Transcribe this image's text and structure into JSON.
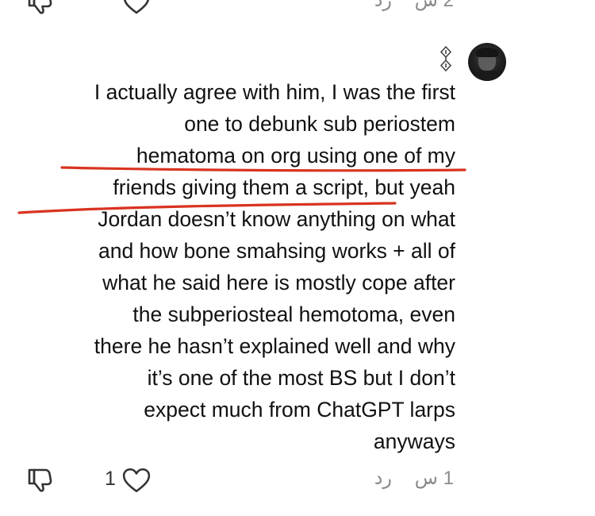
{
  "previous_comment": {
    "time_label": "2 س",
    "reply_label": "رد"
  },
  "comment": {
    "avatar_icon": "profile-photo",
    "badge_icon": "diamond-chain-icon",
    "lines": [
      "I actually agree with him, I was the first",
      "one to debunk sub periostem",
      "hematoma on org using one of my",
      "friends giving them a script, but yeah",
      "Jordan doesn’t know anything on what",
      "and how bone smahsing works + all of",
      "what he said here is mostly cope after",
      "the subperiosteal hemotoma, even",
      "there he hasn’t explained well and why",
      "it’s one of the most BS but I don’t",
      "expect much from ChatGPT larps",
      "anyways"
    ],
    "like_count": "1",
    "time_label": "1 س",
    "reply_label": "رد",
    "annotation_color": "#d93320"
  }
}
